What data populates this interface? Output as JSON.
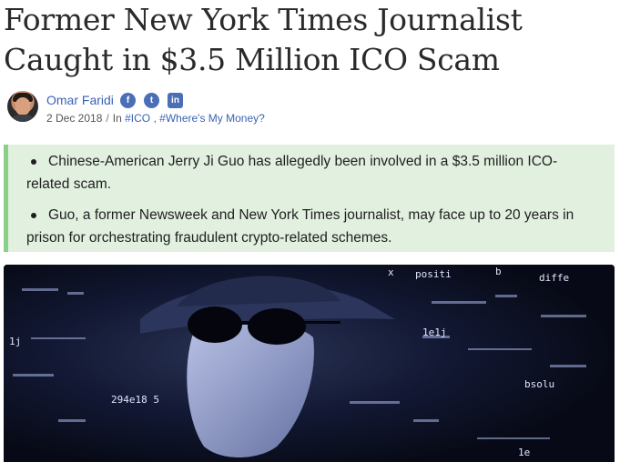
{
  "article": {
    "title": "Former New York Times Journalist Caught in $3.5 Million ICO Scam",
    "author": "Omar Faridi",
    "date": "2 Dec 2018",
    "in_label": "In",
    "tags": [
      "#ICO",
      "#Where's My Money?"
    ],
    "tags_separator": ",",
    "socials": [
      {
        "name": "facebook-icon",
        "glyph": "f"
      },
      {
        "name": "twitter-icon",
        "glyph": "t"
      },
      {
        "name": "linkedin-icon",
        "glyph": "in"
      }
    ],
    "summary": [
      "Chinese-American Jerry Ji Guo has allegedly been involved in a $3.5 million ICO-related scam.",
      "Guo, a former Newsweek and New York Times journalist, may face up to 20 years in prison for orchestrating fraudulent crypto-related schemes."
    ],
    "hero_overlay_text": [
      "positi",
      "b",
      "diffe",
      "x",
      "1e1j",
      "1j",
      "bsolu",
      "294e18 5",
      "1e"
    ]
  },
  "colors": {
    "link": "#3a63b5",
    "summary_bg": "#e1f0df",
    "summary_border": "#8ccf86",
    "hero_bg": "#0b0f20",
    "hero_glow": "#b9c6f2"
  }
}
